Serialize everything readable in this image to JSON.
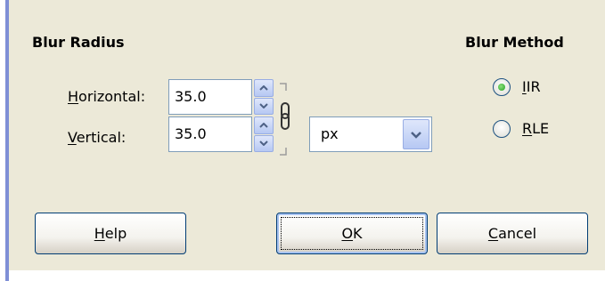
{
  "blur_radius": {
    "heading": "Blur Radius",
    "horizontal": {
      "label_mnemonic": "H",
      "label_rest": "orizontal:",
      "value": "35.0"
    },
    "vertical": {
      "label_mnemonic": "V",
      "label_rest": "ertical:",
      "value": "35.0"
    },
    "chain_icon": "chain-link-icon",
    "unit": {
      "selected": "px"
    }
  },
  "blur_method": {
    "heading": "Blur Method",
    "options": [
      {
        "mnemonic": "I",
        "rest": "IR",
        "selected": true
      },
      {
        "mnemonic": "R",
        "rest": "LE",
        "selected": false
      }
    ]
  },
  "buttons": {
    "help": {
      "mnemonic": "H",
      "rest": "elp"
    },
    "ok": {
      "mnemonic": "O",
      "rest": "K"
    },
    "cancel": {
      "mnemonic": "C",
      "rest": "ancel"
    }
  },
  "colors": {
    "dialog_background": "#ece9d8",
    "accent": "#7f8fd6",
    "radio_selected": "#21a121"
  }
}
